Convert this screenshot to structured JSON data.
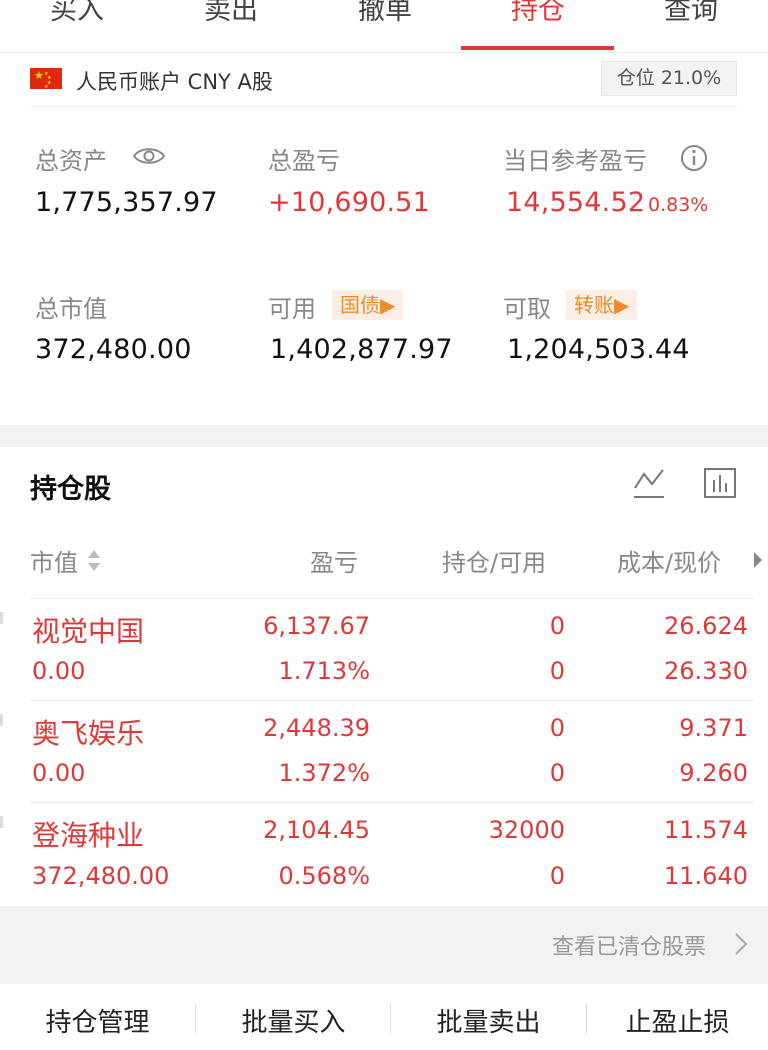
{
  "tabs": [
    {
      "label": "买入"
    },
    {
      "label": "卖出"
    },
    {
      "label": "撤单"
    },
    {
      "label": "持仓"
    },
    {
      "label": "查询"
    }
  ],
  "active_tab": "持仓",
  "account": {
    "label": "人民币账户 CNY A股",
    "position_ratio": "仓位 21.0%"
  },
  "summary": {
    "total_assets_label": "总资产",
    "total_assets": "1,775,357.97",
    "total_pl_label": "总盈亏",
    "total_pl": "+10,690.51",
    "daily_pl_label": "当日参考盈亏",
    "daily_pl": "14,554.52",
    "daily_pl_pct": "0.83%",
    "market_value_label": "总市值",
    "market_value": "372,480.00",
    "available_label": "可用",
    "available_tag": "国债▶",
    "available": "1,402,877.97",
    "withdrawable_label": "可取",
    "withdrawable_tag": "转账▶",
    "withdrawable": "1,204,503.44"
  },
  "holdings": {
    "title": "持仓股",
    "headers": {
      "market_value": "市值",
      "pl": "盈亏",
      "position": "持仓/可用",
      "cost_price": "成本/现价"
    },
    "rows": [
      {
        "name": "视觉中国",
        "market_value": "0.00",
        "pl": "6,137.67",
        "pl_pct": "1.713%",
        "position": "0",
        "available": "0",
        "cost": "26.624",
        "price": "26.330"
      },
      {
        "name": "奥飞娱乐",
        "market_value": "0.00",
        "pl": "2,448.39",
        "pl_pct": "1.372%",
        "position": "0",
        "available": "0",
        "cost": "9.371",
        "price": "9.260"
      },
      {
        "name": "登海种业",
        "market_value": "372,480.00",
        "pl": "2,104.45",
        "pl_pct": "0.568%",
        "position": "32000",
        "available": "0",
        "cost": "11.574",
        "price": "11.640"
      }
    ],
    "view_cleared": "查看已清仓股票"
  },
  "bottom_nav": [
    {
      "label": "持仓管理"
    },
    {
      "label": "批量买入"
    },
    {
      "label": "批量卖出"
    },
    {
      "label": "止盈止损"
    }
  ],
  "colors": {
    "accent": "#e0383a",
    "tag_text": "#ef8a2b",
    "tag_bg": "#fbeee4"
  }
}
